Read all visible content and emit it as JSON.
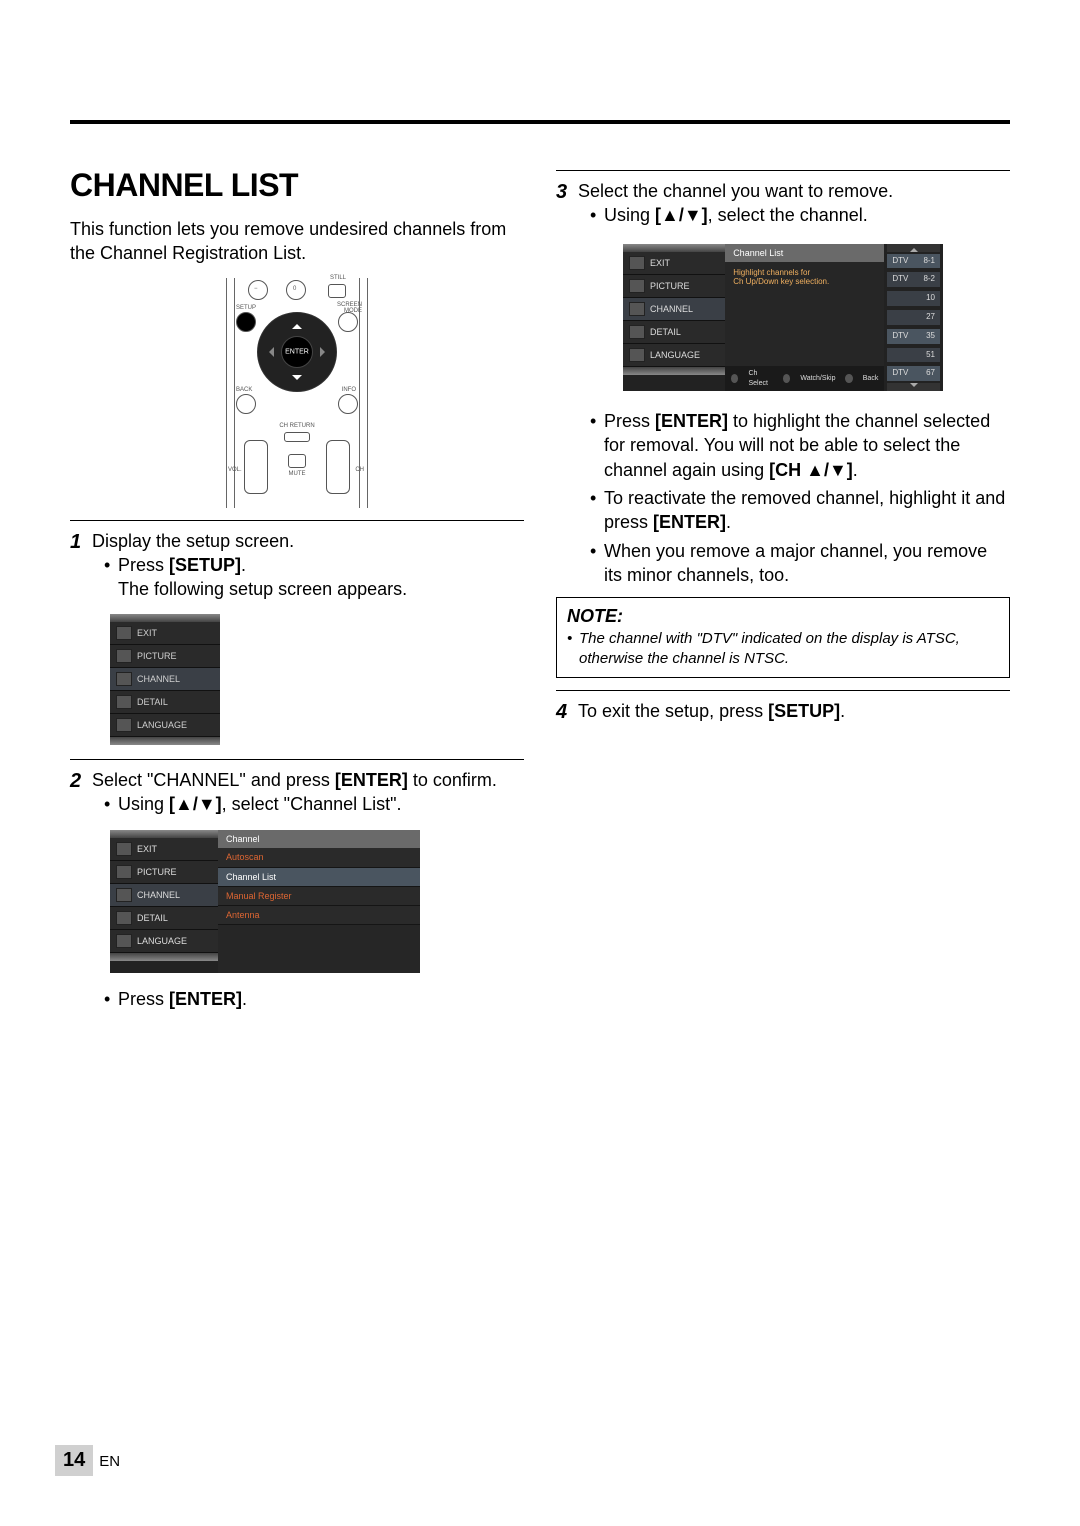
{
  "title": "CHANNEL LIST",
  "intro": "This function lets you remove undesired channels from the Channel Registration List.",
  "remote": {
    "enter": "ENTER",
    "setup": "SETUP",
    "still": "STILL",
    "screen_mode": "SCREEN MODE",
    "back": "BACK",
    "info": "INFO",
    "ch_return": "CH RETURN",
    "vol": "VOL.",
    "ch": "CH",
    "mute": "MUTE",
    "zero": "0",
    "minus": "−"
  },
  "step1": {
    "text": "Display the setup screen.",
    "bullet1_pre": "Press ",
    "bullet1_bold": "[SETUP]",
    "bullet1_post": ".",
    "follow": "The following setup screen appears."
  },
  "setup_menu": {
    "items": [
      "EXIT",
      "PICTURE",
      "CHANNEL",
      "DETAIL",
      "LANGUAGE"
    ]
  },
  "step2": {
    "text_a": "Select \"CHANNEL\" and press ",
    "text_bold1": "[ENTER]",
    "text_b": " to confirm.",
    "bullet_pre": "Using ",
    "bullet_mid": "[▲/▼]",
    "bullet_post": ", select \"Channel List\".",
    "press_pre": "Press ",
    "press_bold": "[ENTER]",
    "press_post": "."
  },
  "channel_menu": {
    "header": "Channel",
    "options": [
      "Autoscan",
      "Channel List",
      "Manual Register",
      "Antenna"
    ]
  },
  "step3": {
    "text": "Select the channel you want to remove.",
    "bullet1_pre": "Using ",
    "bullet1_mid": "[▲/▼]",
    "bullet1_post": ", select the channel.",
    "bullet2_a": "Press ",
    "bullet2_bold1": "[ENTER]",
    "bullet2_b": " to highlight the channel selected for removal. You will not be able to select the channel again using ",
    "bullet2_bold2": "[CH ▲/▼]",
    "bullet2_c": ".",
    "bullet3_a": "To reactivate the removed channel, highlight it and press ",
    "bullet3_bold": "[ENTER]",
    "bullet3_b": ".",
    "bullet4": "When you remove a major channel, you remove its minor channels, too."
  },
  "chlist_screen": {
    "title": "Channel List",
    "instr1": "Highlight channels for",
    "instr2": "Ch Up/Down key selection.",
    "foot_sel": "Ch Select",
    "foot_ws": "Watch/Skip",
    "foot_back": "Back",
    "rows": [
      {
        "label": "DTV",
        "num": "8-1"
      },
      {
        "label": "DTV",
        "num": "8-2"
      },
      {
        "label": "",
        "num": "10"
      },
      {
        "label": "",
        "num": "27"
      },
      {
        "label": "DTV",
        "num": "35"
      },
      {
        "label": "",
        "num": "51"
      },
      {
        "label": "DTV",
        "num": "67"
      }
    ]
  },
  "note": {
    "title": "NOTE:",
    "body": "The channel with \"DTV\" indicated on the display is ATSC, otherwise the channel is NTSC."
  },
  "step4": {
    "text_a": "To exit the setup, press ",
    "text_bold": "[SETUP]",
    "text_b": "."
  },
  "footer": {
    "page": "14",
    "lang": "EN"
  }
}
